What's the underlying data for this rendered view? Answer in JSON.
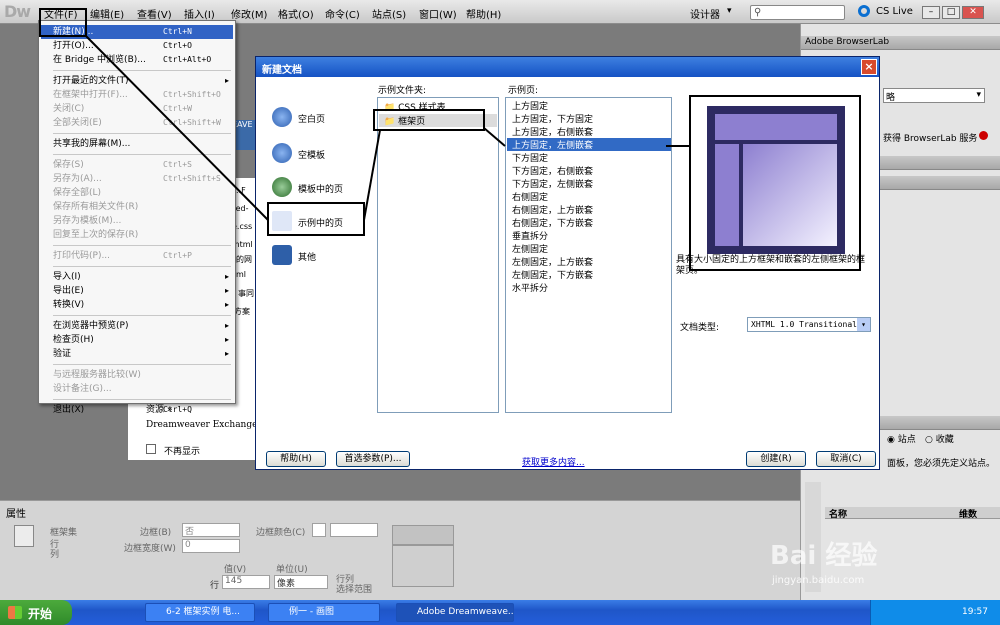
{
  "app": {
    "logo": "Dw"
  },
  "menubar": {
    "items": [
      "文件(F)",
      "编辑(E)",
      "查看(V)",
      "插入(I)",
      "修改(M)",
      "格式(O)",
      "命令(C)",
      "站点(S)",
      "窗口(W)",
      "帮助(H)"
    ],
    "workspace_label": "设计器",
    "cs_live": "CS Live"
  },
  "file_menu": {
    "items": [
      {
        "label": "新建(N)...",
        "shortcut": "Ctrl+N",
        "state": "highlighted"
      },
      {
        "label": "打开(O)...",
        "shortcut": "Ctrl+O"
      },
      {
        "label": "在 Bridge 中浏览(B)...",
        "shortcut": "Ctrl+Alt+O"
      },
      {
        "label": "打开最近的文件(T)",
        "submenu": true
      },
      {
        "label": "在框架中打开(F)...",
        "shortcut": "Ctrl+Shift+O",
        "disabled": true
      },
      {
        "label": "关闭(C)",
        "shortcut": "Ctrl+W",
        "disabled": true
      },
      {
        "label": "全部关闭(E)",
        "shortcut": "Ctrl+Shift+W",
        "disabled": true
      },
      {
        "label": "共享我的屏幕(M)..."
      },
      {
        "label": "保存(S)",
        "shortcut": "Ctrl+S",
        "disabled": true
      },
      {
        "label": "另存为(A)...",
        "shortcut": "Ctrl+Shift+S",
        "disabled": true
      },
      {
        "label": "保存全部(L)",
        "disabled": true
      },
      {
        "label": "保存所有相关文件(R)",
        "disabled": true
      },
      {
        "label": "另存为模板(M)...",
        "disabled": true
      },
      {
        "label": "回复至上次的保存(R)",
        "disabled": true
      },
      {
        "label": "打印代码(P)...",
        "shortcut": "Ctrl+P",
        "disabled": true
      },
      {
        "label": "导入(I)",
        "submenu": true
      },
      {
        "label": "导出(E)",
        "submenu": true
      },
      {
        "label": "转换(V)",
        "submenu": true
      },
      {
        "label": "在浏览器中预览(P)",
        "submenu": true
      },
      {
        "label": "检查页(H)",
        "submenu": true
      },
      {
        "label": "验证",
        "submenu": true
      },
      {
        "label": "与远程服务器比较(W)",
        "disabled": true
      },
      {
        "label": "设计备注(G)...",
        "disabled": true
      },
      {
        "label": "退出(X)",
        "shortcut": "Ctrl+Q"
      }
    ]
  },
  "dialog": {
    "title": "新建文档",
    "categories": [
      "空白页",
      "空模板",
      "模板中的页",
      "示例中的页",
      "其他"
    ],
    "selected_category": "示例中的页",
    "sample_folder_header": "示例文件夹:",
    "sample_folders": [
      "CSS 样式表",
      "框架页"
    ],
    "selected_folder": "框架页",
    "sample_page_header": "示例页:",
    "sample_pages": [
      "上方固定",
      "上方固定，下方固定",
      "上方固定，右侧嵌套",
      "上方固定，左侧嵌套",
      "下方固定",
      "下方固定，右侧嵌套",
      "下方固定，左侧嵌套",
      "右侧固定",
      "右侧固定，上方嵌套",
      "右侧固定，下方嵌套",
      "垂直拆分",
      "左侧固定",
      "左侧固定，上方嵌套",
      "左侧固定，下方嵌套",
      "水平拆分"
    ],
    "selected_page": "上方固定，左侧嵌套",
    "description": "具有大小固定的上方框架和嵌套的左侧框架的框架页。",
    "doctype_label": "文档类型:",
    "doctype_value": "XHTML 1.0 Transitional",
    "buttons": {
      "help": "帮助(H)",
      "prefs": "首选参数(P)...",
      "more": "获取更多内容...",
      "create": "创建(R)",
      "cancel": "取消(C)"
    }
  },
  "welcome_fragments": [
    "..F",
    "itled-",
    "e.css",
    ".html",
    "ml",
    "的网",
    "事同",
    "方案",
    "EAVE"
  ],
  "welcome_bottom": {
    "items": [
      "资源 »",
      "Dreamweaver Exchange"
    ],
    "dont_show": "不再显示"
  },
  "right_panel": {
    "browserlab_title": "Adobe BrowserLab",
    "browserlab_text": "获得 BrowserLab 服务",
    "files_site": "站点",
    "files_fav": "收藏",
    "files_msg": "面板，您必须先定义站点。",
    "col_name": "名称",
    "col_size": "维数",
    "dropdown_fragment": "略"
  },
  "properties": {
    "title": "属性",
    "labels": [
      "框架集",
      "行",
      "列",
      "边框(B)",
      "边框宽度(W)",
      "边框颜色(C)",
      "值(V)",
      "单位(U)",
      "行",
      "行列",
      "选择范围"
    ],
    "border_value": "否",
    "border_width": "0",
    "row_value": "145",
    "unit_value": "像素"
  },
  "taskbar": {
    "start": "开始",
    "tasks": [
      "6-2 框架实例 电...",
      "例一 - 画图",
      "Adobe Dreamweave..."
    ],
    "time": "19:57"
  },
  "watermark": {
    "main": "Bai 经验",
    "sub": "jingyan.baidu.com"
  }
}
